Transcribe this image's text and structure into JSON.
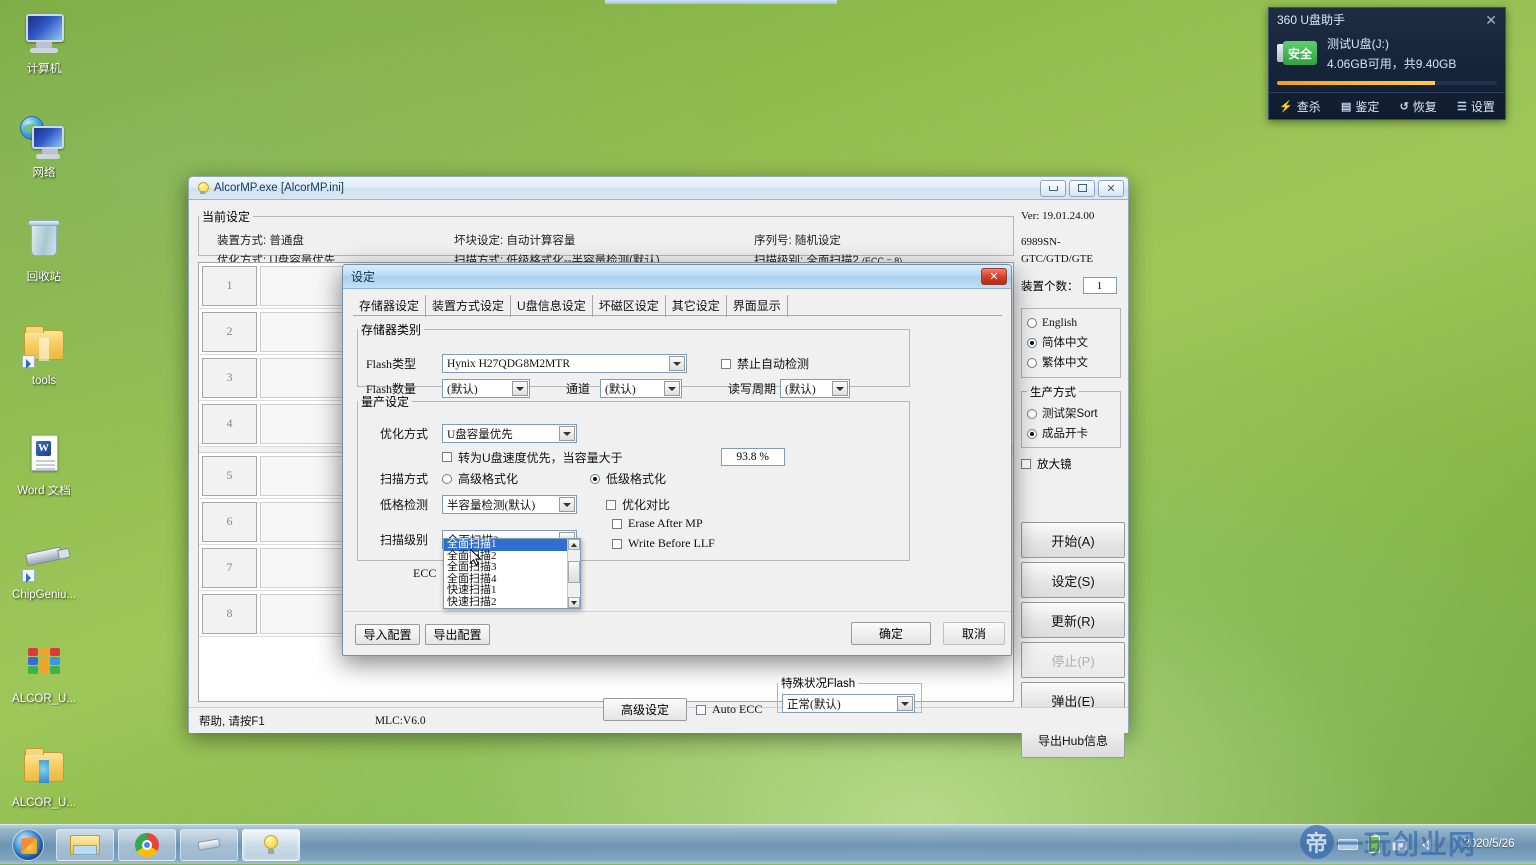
{
  "desktop": {
    "icons": [
      {
        "label": "计算机",
        "icon": "computer-icon"
      },
      {
        "label": "网络",
        "icon": "network-icon"
      },
      {
        "label": "回收站",
        "icon": "recycle-bin-icon"
      },
      {
        "label": "tools",
        "icon": "folder-icon"
      },
      {
        "label": "Word 文档",
        "icon": "word-document-icon"
      },
      {
        "label": "ChipGeniu...",
        "icon": "usb-shortcut-icon"
      },
      {
        "label": "ALCOR_U...",
        "icon": "winrar-archive-icon"
      },
      {
        "label": "ALCOR_U...",
        "icon": "folder-icon"
      }
    ]
  },
  "taskbar": {
    "start_label": "start-orb",
    "buttons": [
      {
        "name": "explorer",
        "icon": "folder-explorer-icon"
      },
      {
        "name": "chrome",
        "icon": "chrome-icon"
      },
      {
        "name": "chipgenius",
        "icon": "usb-icon"
      },
      {
        "name": "alcormp",
        "icon": "bulb-icon"
      }
    ],
    "tray": [
      "keyboard-icon",
      "battery-icon",
      "network-icon",
      "volume-icon"
    ],
    "clock": "2020/5/26",
    "watermark": "一玩创业网"
  },
  "widget360": {
    "title": "360 U盘助手",
    "close": "✕",
    "badge": "安全",
    "device_name": "测试U盘(J:)",
    "capacity": "4.06GB可用，共9.40GB",
    "usage_percent": 72,
    "actions": [
      {
        "label": "查杀",
        "icon": "lightning-icon"
      },
      {
        "label": "鉴定",
        "icon": "grid-icon"
      },
      {
        "label": "恢复",
        "icon": "restore-icon"
      },
      {
        "label": "设置",
        "icon": "list-settings-icon"
      }
    ]
  },
  "main_window": {
    "title": "AlcorMP.exe [AlcorMP.ini]",
    "titlebar_icon": "bulb-icon",
    "buttons": {
      "minimize": "minimize-icon",
      "maximize": "maximize-icon",
      "close": "close-icon"
    },
    "current_settings": {
      "legend": "当前设定",
      "items": [
        {
          "label": "装置方式:",
          "value": "普通盘"
        },
        {
          "label": "坏块设定:",
          "value": "自动计算容量"
        },
        {
          "label": "序列号:",
          "value": "随机设定"
        },
        {
          "label": "优化方式:",
          "value": "U盘容量优先"
        },
        {
          "label": "扫描方式:",
          "value": "低级格式化--半容量检测(默认)"
        },
        {
          "label": "扫描级别:",
          "value": "全面扫描2",
          "sub": "(ECC = 8)"
        }
      ]
    },
    "device_rows": [
      "1",
      "2",
      "3",
      "4",
      "5",
      "6",
      "7",
      "8"
    ],
    "info": {
      "version": "Ver: 19.01.24.00",
      "chipset": "6989SN-GTC/GTD/GTE",
      "device_count_label": "装置个数：",
      "device_count_value": "1"
    },
    "language": {
      "options": [
        {
          "label": "English",
          "selected": false
        },
        {
          "label": "简体中文",
          "selected": true
        },
        {
          "label": "繁体中文",
          "selected": false
        }
      ]
    },
    "production": {
      "legend": "生产方式",
      "options": [
        {
          "label": "测试架Sort",
          "selected": false
        },
        {
          "label": "成品开卡",
          "selected": true
        }
      ]
    },
    "magnifier": {
      "label": "放大镜",
      "checked": false
    },
    "action_buttons": [
      {
        "label": "开始(A)",
        "disabled": false
      },
      {
        "label": "设定(S)",
        "disabled": false
      },
      {
        "label": "更新(R)",
        "disabled": false
      },
      {
        "label": "停止(P)",
        "disabled": true
      },
      {
        "label": "弹出(E)",
        "disabled": false
      },
      {
        "label": "导出Hub信息",
        "disabled": false
      }
    ],
    "status": {
      "help": "帮助, 请按F1",
      "mlc": "MLC:V6.0"
    }
  },
  "settings_dialog": {
    "title": "设定",
    "close": "✕",
    "tabs": [
      {
        "label": "存储器设定",
        "selected": true
      },
      {
        "label": "装置方式设定",
        "selected": false
      },
      {
        "label": "U盘信息设定",
        "selected": false
      },
      {
        "label": "坏磁区设定",
        "selected": false
      },
      {
        "label": "其它设定",
        "selected": false
      },
      {
        "label": "界面显示",
        "selected": false
      }
    ],
    "memory_group": {
      "legend": "存储器类别",
      "flash_type_label": "Flash类型",
      "flash_type_value": "Hynix H27QDG8M2MTR",
      "disable_autodetect": {
        "label": "禁止自动检测",
        "checked": false
      },
      "flash_count_label": "Flash数量",
      "flash_count_value": "(默认)",
      "channel_label": "通道",
      "channel_value": "(默认)",
      "rw_cycle_label": "读写周期",
      "rw_cycle_value": "(默认)"
    },
    "mass_production_group": {
      "legend": "量产设定",
      "optimize_label": "优化方式",
      "optimize_value": "U盘容量优先",
      "speed_priority": {
        "label": "转为U盘速度优先，当容量大于",
        "checked": false
      },
      "capacity_threshold": "93.8 %",
      "scan_method_label": "扫描方式",
      "scan_method_options": [
        {
          "label": "高级格式化",
          "selected": false
        },
        {
          "label": "低级格式化",
          "selected": true
        }
      ],
      "lowlevel_detect_label": "低格检测",
      "lowlevel_detect_value": "半容量检测(默认)",
      "checkboxes": [
        {
          "label": "优化对比",
          "checked": false
        },
        {
          "label": "Erase After MP",
          "checked": false
        },
        {
          "label": "Write Before LLF",
          "checked": false
        }
      ],
      "scan_level_label": "扫描级别",
      "scan_level_value": "全面扫描2",
      "scan_level_options": [
        {
          "label": "全面扫描1",
          "selected": true
        },
        {
          "label": "全面扫描2",
          "selected": false
        },
        {
          "label": "全面扫描3",
          "selected": false
        },
        {
          "label": "全面扫描4",
          "selected": false
        },
        {
          "label": "快速扫描1",
          "selected": false
        },
        {
          "label": "快速扫描2",
          "selected": false
        }
      ],
      "ecc_label": "ECC",
      "advanced_button": "高级设定",
      "auto_ecc": {
        "label": "Auto ECC",
        "checked": false
      },
      "special_flash": {
        "legend": "特殊状况Flash",
        "value": "正常(默认)"
      }
    },
    "footer": {
      "import": "导入配置",
      "export": "导出配置",
      "ok": "确定",
      "cancel": "取消"
    }
  }
}
